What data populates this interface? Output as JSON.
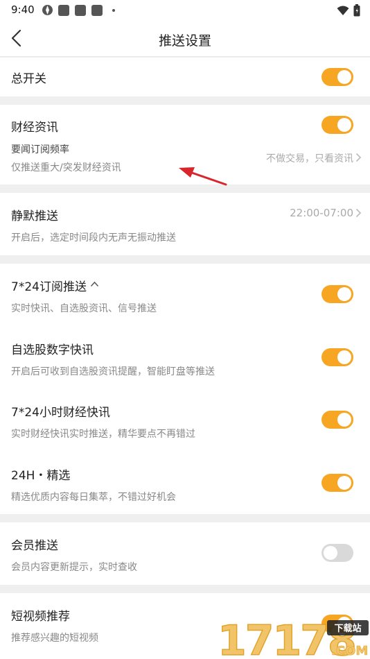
{
  "status_bar": {
    "time": "9:40"
  },
  "header": {
    "title": "推送设置"
  },
  "master": {
    "label": "总开关",
    "enabled": true
  },
  "finance": {
    "label": "财经资讯",
    "enabled": true,
    "freq_label": "要闻订阅频率",
    "freq_desc": "仅推送重大/突发财经资讯",
    "freq_value": "不做交易，只看资讯"
  },
  "quiet": {
    "label": "静默推送",
    "time_range": "22:00-07:00",
    "desc": "开启后，选定时间段内无声无振动推送"
  },
  "subscriptions": [
    {
      "label": "7*24订阅推送",
      "desc": "实时快讯、自选股资讯、信号推送",
      "enabled": true
    },
    {
      "label": "自选股数字快讯",
      "desc": "开启后可收到自选股资讯提醒，智能盯盘等推送",
      "enabled": true
    },
    {
      "label": "7*24小时财经快讯",
      "desc": "实时财经快讯实时推送，精华要点不再错过",
      "enabled": true
    },
    {
      "label": "24H・精选",
      "desc": "精选优质内容每日集萃，不错过好机会",
      "enabled": true
    }
  ],
  "member": {
    "label": "会员推送",
    "desc": "会员内容更新提示，实时查收",
    "enabled": false
  },
  "video": {
    "label": "短视频推荐",
    "desc": "推荐感兴趣的短视频",
    "enabled": true
  },
  "watermark": {
    "text": "17178",
    "domain": ".COM",
    "badge": "下载站"
  },
  "colors": {
    "accent": "#f6a623",
    "toggle_off": "#d9d9d9",
    "arrow": "#d9262c"
  }
}
